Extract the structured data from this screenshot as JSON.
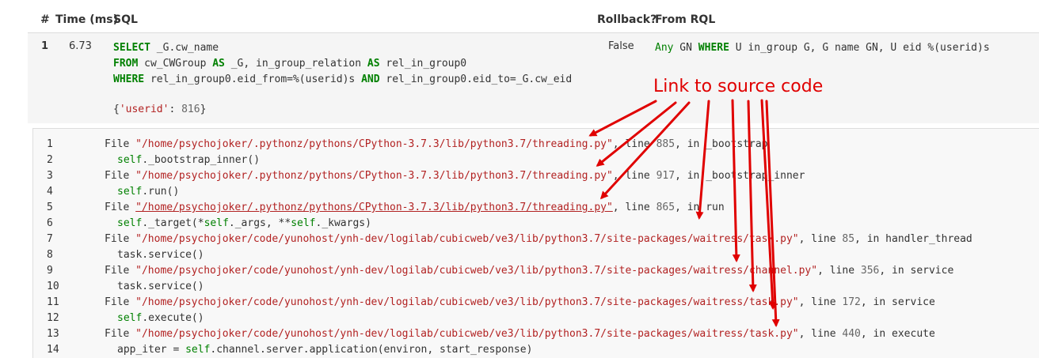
{
  "headers": {
    "num": "#",
    "time": "Time (ms)",
    "sql": "SQL",
    "rollback": "Rollback?",
    "rql": "From RQL"
  },
  "row": {
    "num": "1",
    "time": "6.73",
    "rollback": "False",
    "sql": [
      [
        {
          "t": "SELECT",
          "c": "kw"
        },
        {
          "t": " _G.cw_name"
        }
      ],
      [
        {
          "t": "FROM",
          "c": "kw"
        },
        {
          "t": " cw_CWGroup "
        },
        {
          "t": "AS",
          "c": "kw"
        },
        {
          "t": " _G, in_group_relation "
        },
        {
          "t": "AS",
          "c": "kw"
        },
        {
          "t": " rel_in_group0"
        }
      ],
      [
        {
          "t": "WHERE",
          "c": "kw"
        },
        {
          "t": " rel_in_group0.eid_from=%(userid)s "
        },
        {
          "t": "AND",
          "c": "kw"
        },
        {
          "t": " rel_in_group0.eid_to=_G.cw_eid"
        }
      ]
    ],
    "params": [
      {
        "t": "{"
      },
      {
        "t": "'userid'",
        "c": "str"
      },
      {
        "t": ": "
      },
      {
        "t": "816",
        "c": "num"
      },
      {
        "t": "}"
      }
    ],
    "rql": [
      {
        "t": "Any",
        "c": "kw2"
      },
      {
        "t": " GN "
      },
      {
        "t": "WHERE",
        "c": "kw"
      },
      {
        "t": " U in_group G, G name GN, U eid %(userid)s"
      }
    ]
  },
  "annotation": "Link to source code",
  "annotation_color": "#e00000",
  "traceback": [
    {
      "n": "1",
      "ind": false,
      "parts": [
        {
          "t": "File "
        },
        {
          "t": "\"/home/psychojoker/.pythonz/pythons/CPython-3.7.3/lib/python3.7/threading.py\"",
          "c": "fpath",
          "link": true
        },
        {
          "t": ", line "
        },
        {
          "t": "885",
          "c": "num"
        },
        {
          "t": ", in _bootstrap"
        }
      ]
    },
    {
      "n": "2",
      "ind": true,
      "parts": [
        {
          "t": "self",
          "c": "self"
        },
        {
          "t": "._bootstrap_inner()"
        }
      ]
    },
    {
      "n": "3",
      "ind": false,
      "parts": [
        {
          "t": "File "
        },
        {
          "t": "\"/home/psychojoker/.pythonz/pythons/CPython-3.7.3/lib/python3.7/threading.py\"",
          "c": "fpath",
          "link": true
        },
        {
          "t": ", line "
        },
        {
          "t": "917",
          "c": "num"
        },
        {
          "t": ", in _bootstrap_inner"
        }
      ]
    },
    {
      "n": "4",
      "ind": true,
      "parts": [
        {
          "t": "self",
          "c": "self"
        },
        {
          "t": ".run()"
        }
      ]
    },
    {
      "n": "5",
      "ind": false,
      "parts": [
        {
          "t": "File "
        },
        {
          "t": "\"/home/psychojoker/.pythonz/pythons/CPython-3.7.3/lib/python3.7/threading.py\"",
          "c": "fpath ul",
          "link": true
        },
        {
          "t": ", line "
        },
        {
          "t": "865",
          "c": "num"
        },
        {
          "t": ", in run"
        }
      ]
    },
    {
      "n": "6",
      "ind": true,
      "parts": [
        {
          "t": "self",
          "c": "self"
        },
        {
          "t": "._target(*"
        },
        {
          "t": "self",
          "c": "self"
        },
        {
          "t": "._args, **"
        },
        {
          "t": "self",
          "c": "self"
        },
        {
          "t": "._kwargs)"
        }
      ]
    },
    {
      "n": "7",
      "ind": false,
      "parts": [
        {
          "t": "File "
        },
        {
          "t": "\"/home/psychojoker/code/yunohost/ynh-dev/logilab/cubicweb/ve3/lib/python3.7/site-packages/waitress/task.py\"",
          "c": "fpath",
          "link": true
        },
        {
          "t": ", line "
        },
        {
          "t": "85",
          "c": "num"
        },
        {
          "t": ", in handler_thread"
        }
      ]
    },
    {
      "n": "8",
      "ind": true,
      "parts": [
        {
          "t": "task.service()"
        }
      ]
    },
    {
      "n": "9",
      "ind": false,
      "parts": [
        {
          "t": "File "
        },
        {
          "t": "\"/home/psychojoker/code/yunohost/ynh-dev/logilab/cubicweb/ve3/lib/python3.7/site-packages/waitress/channel.py\"",
          "c": "fpath",
          "link": true
        },
        {
          "t": ", line "
        },
        {
          "t": "356",
          "c": "num"
        },
        {
          "t": ", in service"
        }
      ]
    },
    {
      "n": "10",
      "ind": true,
      "parts": [
        {
          "t": "task.service()"
        }
      ]
    },
    {
      "n": "11",
      "ind": false,
      "parts": [
        {
          "t": "File "
        },
        {
          "t": "\"/home/psychojoker/code/yunohost/ynh-dev/logilab/cubicweb/ve3/lib/python3.7/site-packages/waitress/task.py\"",
          "c": "fpath",
          "link": true
        },
        {
          "t": ", line "
        },
        {
          "t": "172",
          "c": "num"
        },
        {
          "t": ", in service"
        }
      ]
    },
    {
      "n": "12",
      "ind": true,
      "parts": [
        {
          "t": "self",
          "c": "self"
        },
        {
          "t": ".execute()"
        }
      ]
    },
    {
      "n": "13",
      "ind": false,
      "parts": [
        {
          "t": "File "
        },
        {
          "t": "\"/home/psychojoker/code/yunohost/ynh-dev/logilab/cubicweb/ve3/lib/python3.7/site-packages/waitress/task.py\"",
          "c": "fpath",
          "link": true
        },
        {
          "t": ", line "
        },
        {
          "t": "440",
          "c": "num"
        },
        {
          "t": ", in execute"
        }
      ]
    },
    {
      "n": "14",
      "ind": true,
      "parts": [
        {
          "t": "app_iter = "
        },
        {
          "t": "self",
          "c": "self"
        },
        {
          "t": ".channel.server.application(environ, start_response)"
        }
      ]
    }
  ]
}
